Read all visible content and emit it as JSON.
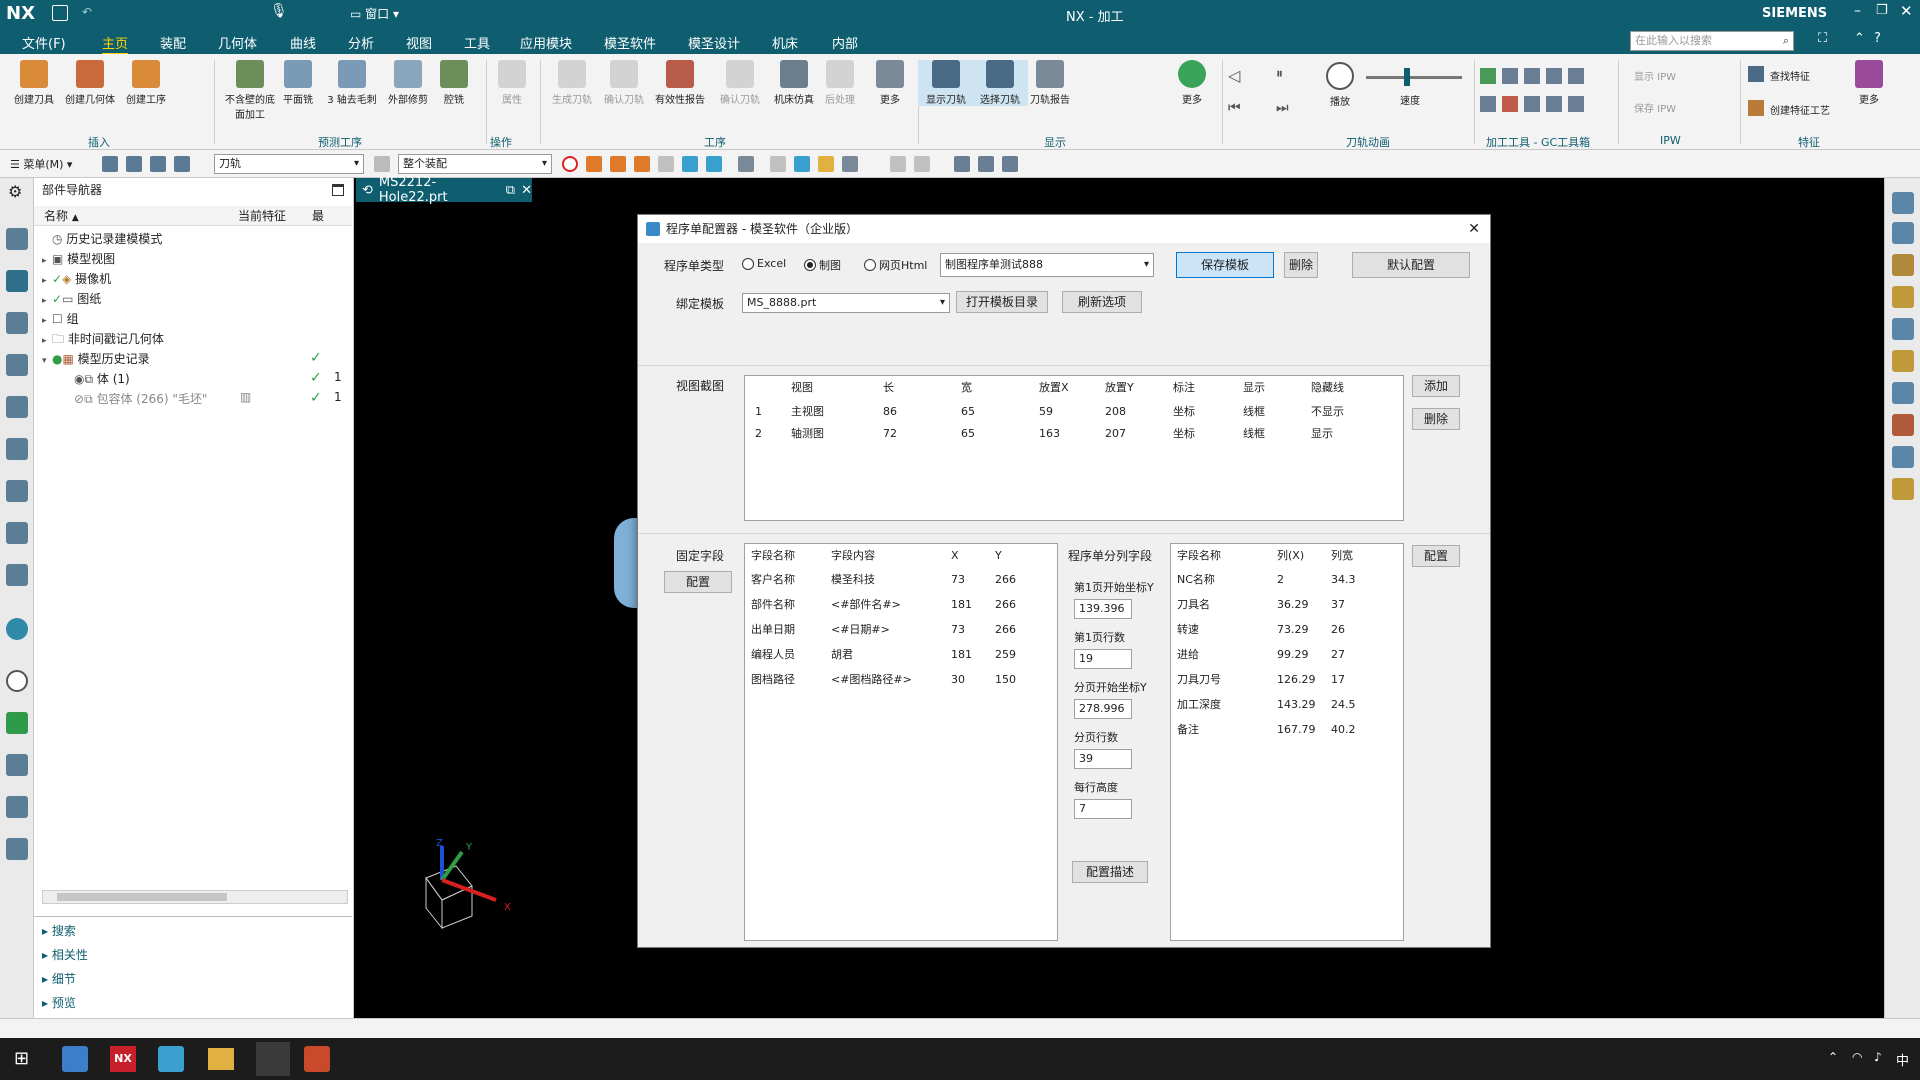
{
  "app": {
    "logo": "NX",
    "window_title": "NX - 加工",
    "brand": "SIEMENS",
    "search_placeholder": "在此输入以搜索"
  },
  "menu": [
    "文件(F)",
    "主页",
    "装配",
    "几何体",
    "曲线",
    "分析",
    "视图",
    "工具",
    "应用模块",
    "模圣软件",
    "模圣设计",
    "机床",
    "内部"
  ],
  "ribbon": {
    "insert": {
      "label": "插入",
      "buttons": [
        "创建刀具",
        "创建几何体",
        "创建工序"
      ]
    },
    "predict": {
      "label": "预测工序",
      "buttons": [
        "不含壁的底面加工",
        "平面铣",
        "3 轴去毛刺",
        "外部修剪",
        "腔铣"
      ]
    },
    "ops": {
      "label": "操作",
      "buttons": [
        "属性"
      ]
    },
    "proc": {
      "label": "工序",
      "buttons": [
        "生成刀轨",
        "确认刀轨",
        "有效性报告",
        "确认刀轨",
        "机床仿真",
        "后处理",
        "更多"
      ]
    },
    "display": {
      "label": "显示",
      "buttons": [
        "显示刀轨",
        "选择刀轨",
        "刀轨报告",
        "更多"
      ]
    },
    "anim": {
      "label": "刀轨动画",
      "buttons": [
        "播放",
        "速度"
      ]
    },
    "gc": {
      "label": "加工工具 - GC工具箱"
    },
    "ipw": {
      "label": "IPW",
      "buttons": [
        "显示 IPW",
        "保存 IPW"
      ]
    },
    "feature": {
      "label": "特征",
      "buttons": [
        "查找特征",
        "创建特征工艺",
        "更多"
      ]
    }
  },
  "toolbar2": {
    "menu_label": "菜单(M)",
    "filter_value": "刀轨",
    "scope_value": "整个装配"
  },
  "nav": {
    "title": "部件导航器",
    "col_name": "名称",
    "col_feature": "当前特征",
    "col_last": "最",
    "rows": [
      {
        "label": "历史记录建模模式"
      },
      {
        "label": "模型视图"
      },
      {
        "label": "摄像机"
      },
      {
        "label": "图纸"
      },
      {
        "label": "组"
      },
      {
        "label": "非时间戳记几何体"
      },
      {
        "label": "模型历史记录"
      },
      {
        "label": "体 (1)",
        "last": "1"
      },
      {
        "label": "包容体 (266) \"毛坯\"",
        "last": "1"
      }
    ],
    "sections": [
      "搜索",
      "相关性",
      "细节",
      "预览"
    ]
  },
  "doc_tab": "MS2212-Hole22.prt",
  "dialog": {
    "title": "程序单配置器 - 模圣软件（企业版）",
    "type_label": "程序单类型",
    "radios": [
      {
        "label": "Excel",
        "selected": false
      },
      {
        "label": "制图",
        "selected": true
      },
      {
        "label": "网页Html",
        "selected": false
      }
    ],
    "template_combo": "制图程序单测试888",
    "btn_save": "保存模板",
    "btn_delete": "删除",
    "btn_default": "默认配置",
    "bind_label": "绑定模板",
    "bind_combo": "MS_8888.prt",
    "btn_open_dir": "打开模板目录",
    "btn_refresh": "刷新选项",
    "view_section_label": "视图截图",
    "view_table": {
      "headers": [
        "视图",
        "长",
        "宽",
        "放置X",
        "放置Y",
        "标注",
        "显示",
        "隐藏线"
      ],
      "rows": [
        [
          "1",
          "主视图",
          "86",
          "65",
          "59",
          "208",
          "坐标",
          "线框",
          "不显示"
        ],
        [
          "2",
          "轴测图",
          "72",
          "65",
          "163",
          "207",
          "坐标",
          "线框",
          "显示"
        ]
      ]
    },
    "btn_add": "添加",
    "btn_remove": "删除",
    "fixed_label": "固定字段",
    "btn_config_left": "配置",
    "fixed_table": {
      "headers": [
        "字段名称",
        "字段内容",
        "X",
        "Y"
      ],
      "rows": [
        [
          "客户名称",
          "模圣科技",
          "73",
          "266"
        ],
        [
          "部件名称",
          "<#部件名#>",
          "181",
          "266"
        ],
        [
          "出单日期",
          "<#日期#>",
          "73",
          "266"
        ],
        [
          "编程人员",
          "胡君",
          "181",
          "259"
        ],
        [
          "图档路径",
          "<#图档路径#>",
          "30",
          "150"
        ]
      ]
    },
    "split_label": "程序单分列字段",
    "split_fields": [
      {
        "label": "第1页开始坐标Y",
        "value": "139.396"
      },
      {
        "label": "第1页行数",
        "value": "19"
      },
      {
        "label": "分页开始坐标Y",
        "value": "278.996"
      },
      {
        "label": "分页行数",
        "value": "39"
      },
      {
        "label": "每行高度",
        "value": "7"
      }
    ],
    "btn_config_desc": "配置描述",
    "col_table": {
      "headers": [
        "字段名称",
        "列(X)",
        "列宽"
      ],
      "rows": [
        [
          "NC名称",
          "2",
          "34.3"
        ],
        [
          "刀具名",
          "36.29",
          "37"
        ],
        [
          "转速",
          "73.29",
          "26"
        ],
        [
          "进给",
          "99.29",
          "27"
        ],
        [
          "刀具刀号",
          "126.29",
          "17"
        ],
        [
          "加工深度",
          "143.29",
          "24.5"
        ],
        [
          "备注",
          "167.79",
          "40.2"
        ]
      ]
    },
    "btn_config_right": "配置"
  },
  "taskbar": {
    "ime": "中"
  }
}
